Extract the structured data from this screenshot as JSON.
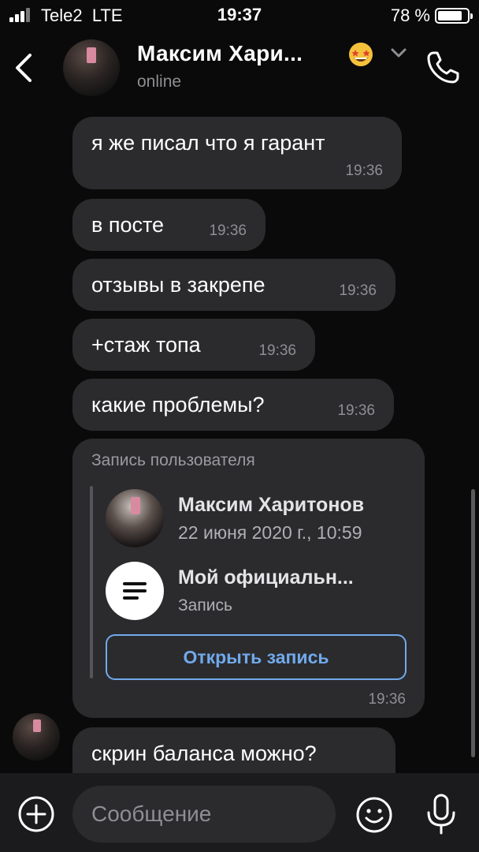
{
  "status_bar": {
    "carrier": "Tele2",
    "network": "LTE",
    "time": "19:37",
    "battery": "78 %",
    "battery_level": 0.78
  },
  "header": {
    "name": "Максим Хари...",
    "status": "online",
    "icons": {
      "back": "chevron-left-icon",
      "emoji": "star-struck-emoji",
      "expand": "chevron-down-icon",
      "call": "phone-icon"
    }
  },
  "messages": [
    {
      "text": "я же писал что я гарант",
      "time": "19:36"
    },
    {
      "text": "в посте",
      "time": "19:36"
    },
    {
      "text": "отзывы в закрепе",
      "time": "19:36"
    },
    {
      "text": "+стаж топа",
      "time": "19:36"
    },
    {
      "text": "какие проблемы?",
      "time": "19:36"
    }
  ],
  "shared_post": {
    "label": "Запись пользователя",
    "author": "Максим Харитонов",
    "date": "22 июня 2020 г., 10:59",
    "title": "Мой официальн...",
    "type": "Запись",
    "button": "Открыть запись",
    "time": "19:36"
  },
  "last_message": {
    "text": "скрин баланса можно?"
  },
  "composer": {
    "placeholder": "Сообщение",
    "icons": {
      "attach": "plus-circle-icon",
      "emoji": "smile-icon",
      "voice": "microphone-icon"
    }
  }
}
